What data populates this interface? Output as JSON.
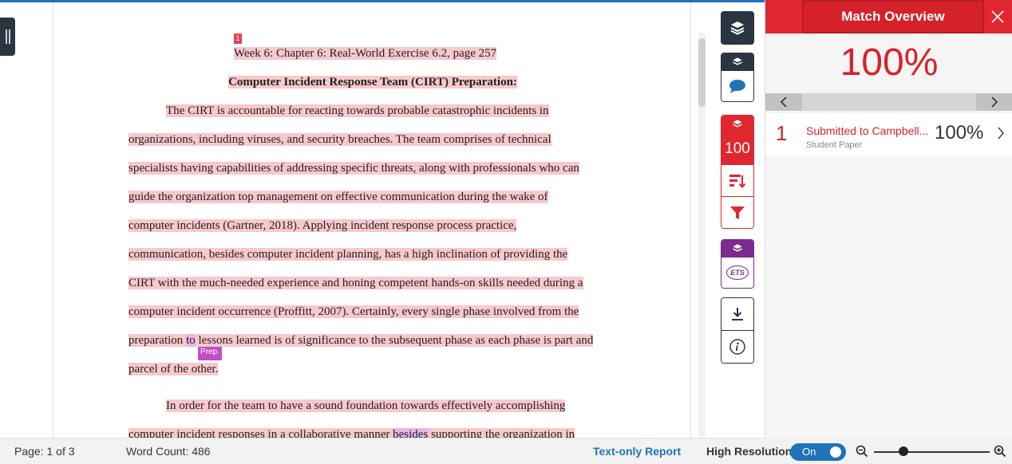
{
  "document": {
    "page_marker": "1",
    "lines": [
      [
        {
          "t": "Week 6: Chapter 6: Real-World Exercise 6.2, page 257",
          "h": "hl"
        }
      ],
      [
        {
          "t": "Computer Incident Response Team (CIRT) Preparation:",
          "h": "hl"
        }
      ],
      [
        {
          "t": "The CIRT is accountable for reacting towards probable catastrophic incidents in",
          "h": "hl"
        }
      ],
      [
        {
          "t": "organizations, including viruses, and security breaches. The team comprises of technical",
          "h": "hl"
        }
      ],
      [
        {
          "t": "specialists having capabilities of addressing specific threats, along with professionals who can",
          "h": "hl"
        }
      ],
      [
        {
          "t": "guide the organization top management on effective communication during the wake of",
          "h": "hl"
        }
      ],
      [
        {
          "t": "computer incidents (Gartner, 2018).  Applying incident response process practice,",
          "h": "hl"
        }
      ],
      [
        {
          "t": "communication, besides computer incident planning, has a high inclination of providing the",
          "h": "hl"
        }
      ],
      [
        {
          "t": "CIRT with the much-needed experience and honing competent hands-on skills needed during a",
          "h": "hl"
        }
      ],
      [
        {
          "t": "computer incident occurrence (Proffitt, 2007). Certainly, every single phase involved from the",
          "h": "hl"
        }
      ],
      [
        {
          "t": "preparation ",
          "h": "hl"
        },
        {
          "t": "to",
          "h": "pk"
        },
        {
          "t": " lessons learned is of significance to the subsequent phase as each phase is part and",
          "h": "hl"
        }
      ],
      [
        {
          "t": "parcel of the other.",
          "h": "hl"
        }
      ],
      [
        {
          "t": "In order for the team to have a sound foundation towards effectively accomplishing",
          "h": "hl"
        }
      ],
      [
        {
          "t": "computer incident responses in a collaborative manner ",
          "h": "hl"
        },
        {
          "t": "besides",
          "h": "pk"
        },
        {
          "t": " supporting the organization in",
          "h": "hl"
        }
      ]
    ],
    "grammar_tag": "Prep."
  },
  "toolbar": {
    "match_count": "100",
    "ets_label": "ETS"
  },
  "panel": {
    "title": "Match Overview",
    "overall_percent": "100%",
    "sources": [
      {
        "rank": "1",
        "name": "Submitted to Campbell...",
        "type": "Student Paper",
        "percent": "100%"
      }
    ]
  },
  "status": {
    "page": "Page: 1 of 3",
    "word_count": "Word Count: 486",
    "text_only_report": "Text-only Report",
    "high_resolution": "High Resolution",
    "toggle_state": "On"
  },
  "colors": {
    "match_red": "#e0262e",
    "highlight_pink": "#f8c8cc",
    "grammar_purple": "#c04ec7",
    "link_blue": "#1f73b7",
    "dark": "#2b3541"
  }
}
